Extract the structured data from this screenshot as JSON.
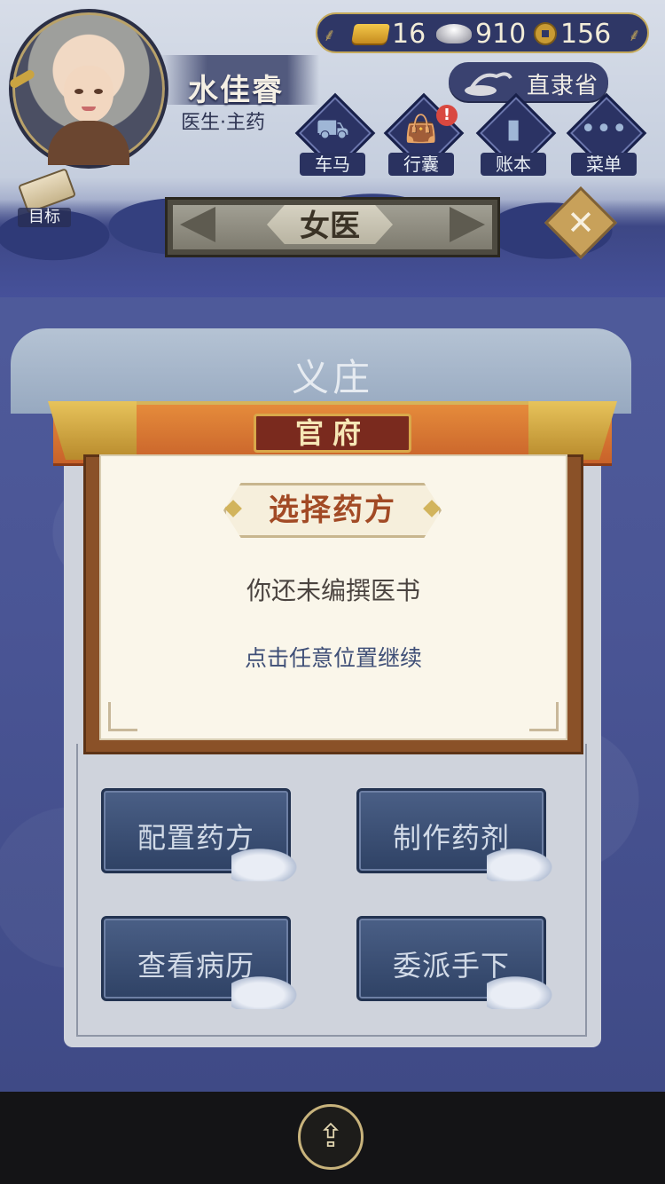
{
  "header": {
    "player_name": "水佳睿",
    "player_title": "医生·主药",
    "currency": {
      "gold": "16",
      "silver": "910",
      "copper": "156"
    },
    "location": "直隶省"
  },
  "menu": [
    {
      "label": "车马",
      "icon": "carriage-icon",
      "badge": ""
    },
    {
      "label": "行囊",
      "icon": "bag-icon",
      "badge": "!"
    },
    {
      "label": "账本",
      "icon": "ledger-icon",
      "badge": ""
    },
    {
      "label": "菜单",
      "icon": "menu-dots-icon",
      "badge": ""
    }
  ],
  "target_label": "目标",
  "banner_title": "女医",
  "place_name": "义庄",
  "notice": {
    "plaque": "官府",
    "title": "选择药方",
    "message": "你还未编撰医书",
    "hint": "点击任意位置继续"
  },
  "actions": [
    "配置药方",
    "制作药剂",
    "查看病历",
    "委派手下"
  ],
  "colors": {
    "accent_orange": "#e58b3b",
    "panel_blue": "#3f4a86",
    "notice_title": "#a24a25"
  }
}
